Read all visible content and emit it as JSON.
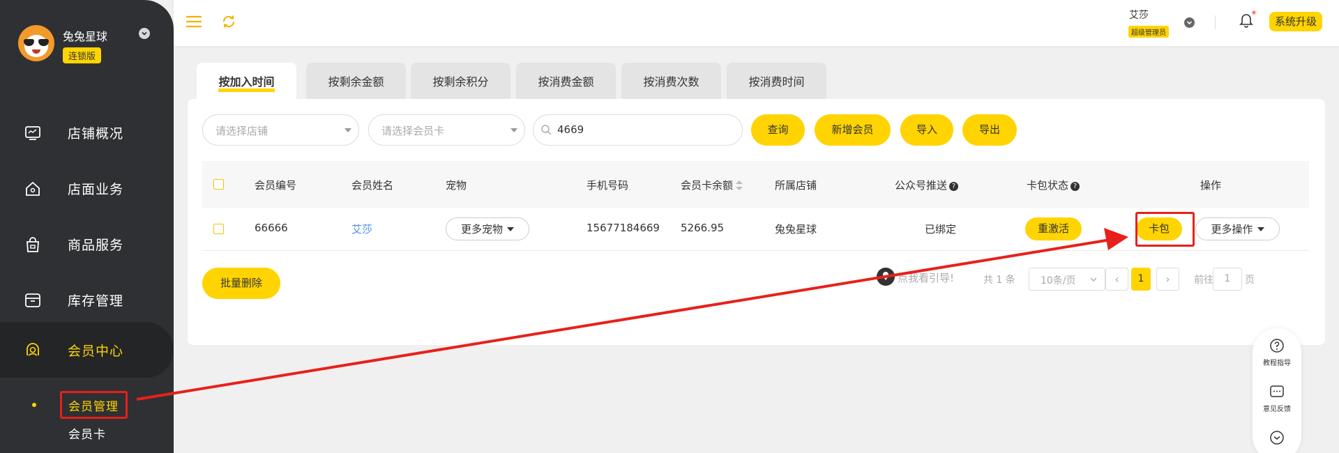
{
  "sidebar": {
    "brand_name": "兔兔星球",
    "brand_badge": "连锁版",
    "nav": [
      {
        "label": "店铺概况",
        "icon": "monitor-icon"
      },
      {
        "label": "店面业务",
        "icon": "house-icon"
      },
      {
        "label": "商品服务",
        "icon": "shopping-bag-icon"
      },
      {
        "label": "库存管理",
        "icon": "archive-box-icon"
      },
      {
        "label": "会员中心",
        "icon": "member-badge-icon"
      }
    ],
    "sub": [
      {
        "label": "会员管理"
      },
      {
        "label": "会员卡"
      }
    ]
  },
  "topbar": {
    "user_name": "艾莎",
    "user_role": "超级管理员",
    "upgrade_label": "系统升级"
  },
  "tabs": [
    "按加入时间",
    "按剩余金额",
    "按剩余积分",
    "按消费金额",
    "按消费次数",
    "按消费时间"
  ],
  "filters": {
    "store_placeholder": "请选择店铺",
    "card_placeholder": "请选择会员卡",
    "search_value": "4669",
    "query_label": "查询",
    "add_label": "新增会员",
    "import_label": "导入",
    "export_label": "导出"
  },
  "table": {
    "headers": {
      "id": "会员编号",
      "name": "会员姓名",
      "pet": "宠物",
      "phone": "手机号码",
      "balance": "会员卡余额",
      "store": "所属店铺",
      "wechat": "公众号推送",
      "cardpack": "卡包状态",
      "ops": "操作"
    },
    "rows": [
      {
        "id": "66666",
        "name": "艾莎",
        "pet": "更多宠物",
        "phone": "15677184669",
        "balance": "5266.95",
        "store": "兔兔星球",
        "wechat": "已绑定",
        "cardpack": "重激活",
        "op_card": "卡包",
        "op_more": "更多操作"
      }
    ]
  },
  "footer": {
    "batch_delete": "批量删除",
    "guide": "点我看引导!",
    "total": "共 1 条",
    "page_size": "10条/页",
    "current_page": "1",
    "goto_label": "前往",
    "goto_value": "1",
    "goto_suffix": "页"
  },
  "float_panel": {
    "help": "教程指导",
    "feedback": "意见反馈"
  },
  "colors": {
    "accent": "#ffd400",
    "sidebar_bg": "#2f3033",
    "annotation_red": "#e8201a"
  }
}
